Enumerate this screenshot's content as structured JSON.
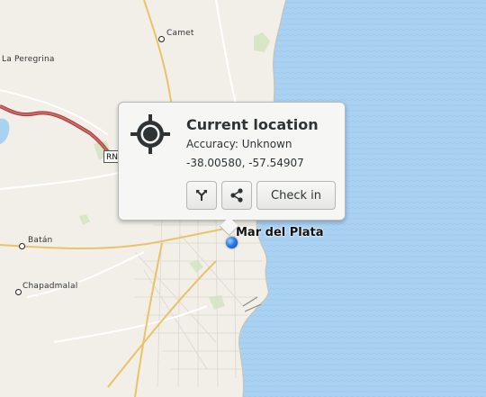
{
  "map": {
    "places": {
      "camet": "Camet",
      "la_peregrina": "La Peregrina",
      "batan": "Batán",
      "chapadmalal": "Chapadmalal",
      "city": "Mar del Plata"
    },
    "route_shield": "RN",
    "colors": {
      "sea": "#a8d0f0",
      "land": "#f1efe8",
      "major_road": "#e8c36a",
      "highway": "#c64b4b",
      "park": "#d6e6c2"
    }
  },
  "popover": {
    "title": "Current location",
    "accuracy": "Accuracy: Unknown",
    "coordinates": "-38.00580, -57.54907",
    "icon": "location-crosshair-icon",
    "route_icon": "route-icon",
    "share_icon": "share-icon",
    "checkin_label": "Check in"
  },
  "location": {
    "latitude": -38.0058,
    "longitude": -57.54907
  }
}
